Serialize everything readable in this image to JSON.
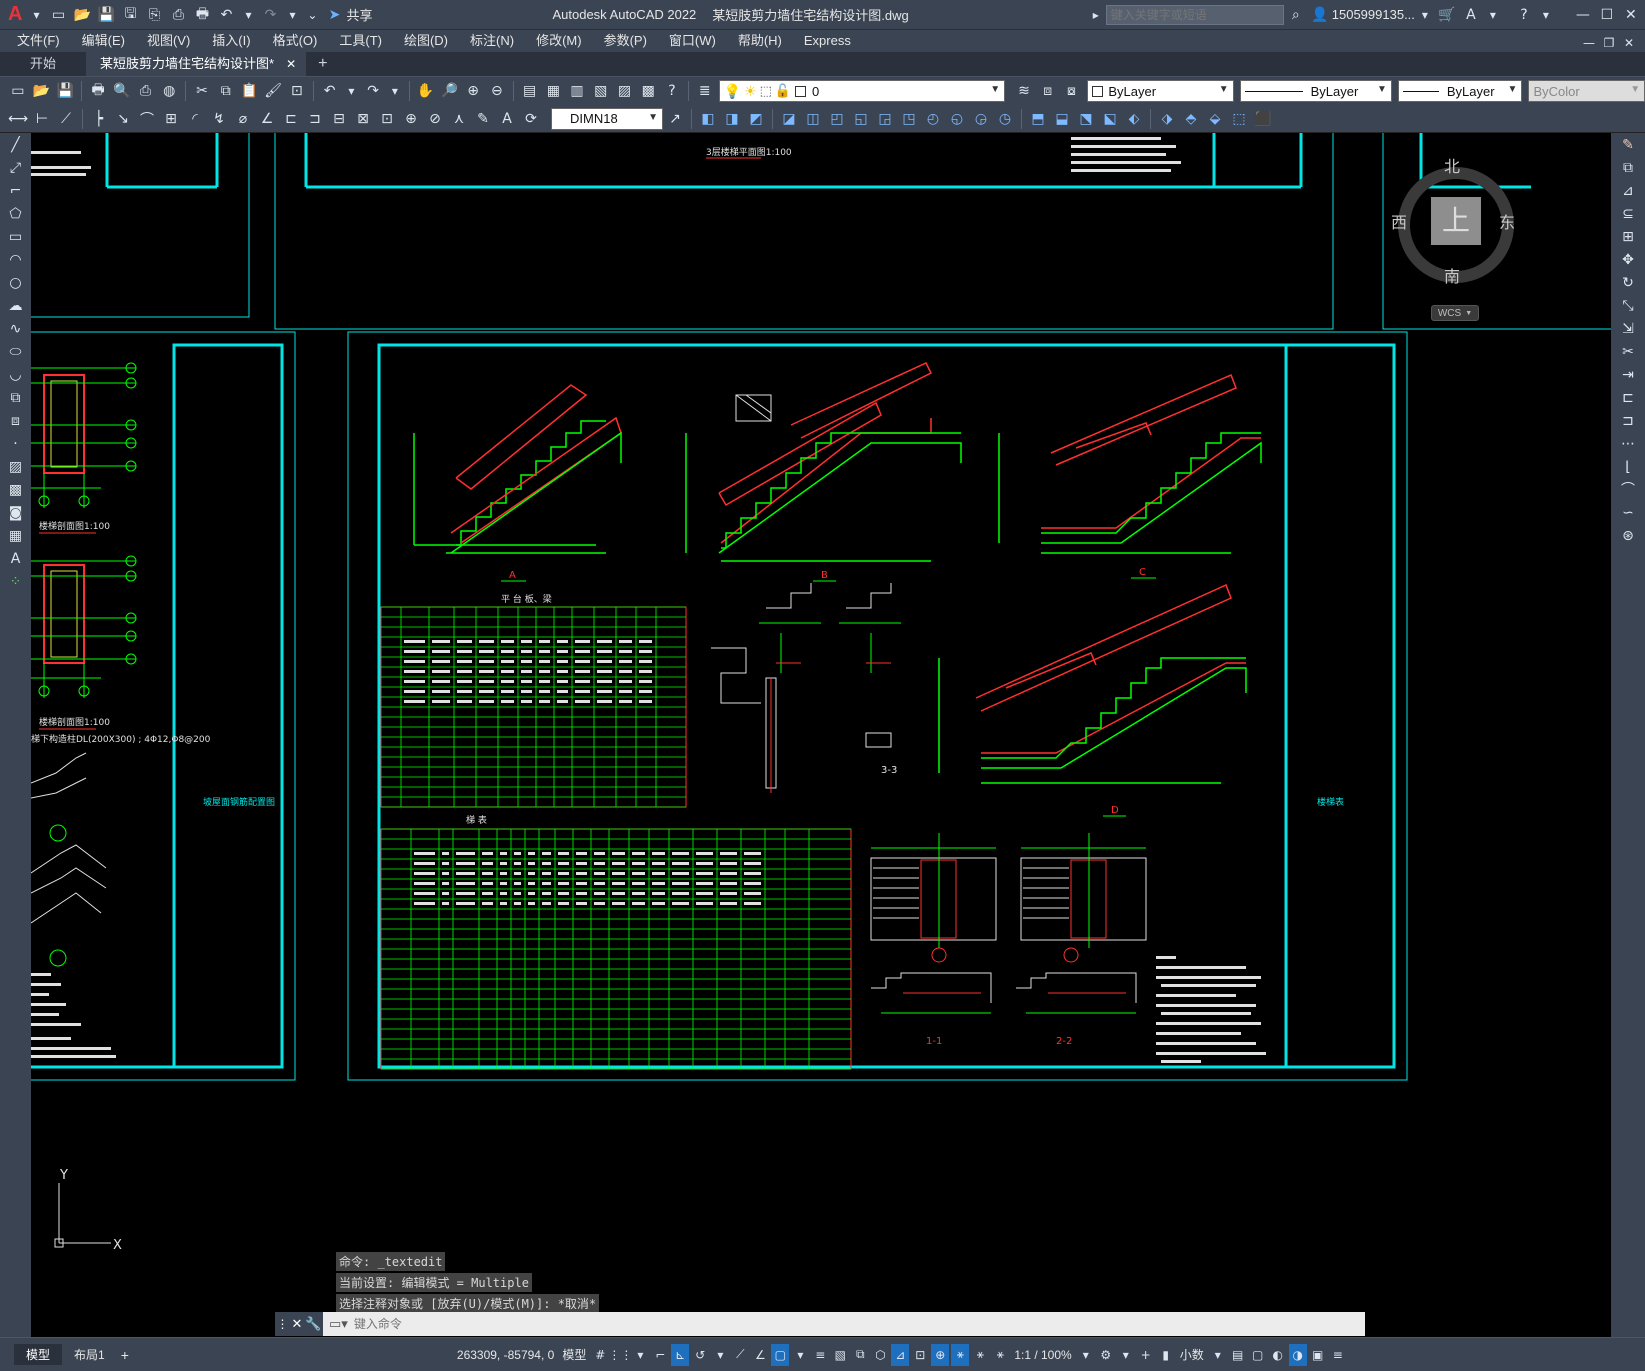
{
  "title": {
    "app_logo": "A",
    "app_name": "Autodesk AutoCAD 2022",
    "file_name": "某短肢剪力墙住宅结构设计图.dwg",
    "share_label": "共享",
    "search_placeholder": "键入关键字或短语",
    "user_label": "1505999135..."
  },
  "menu": [
    "文件(F)",
    "编辑(E)",
    "视图(V)",
    "插入(I)",
    "格式(O)",
    "工具(T)",
    "绘图(D)",
    "标注(N)",
    "修改(M)",
    "参数(P)",
    "窗口(W)",
    "帮助(H)",
    "Express"
  ],
  "tabs": {
    "start": "开始",
    "doc": "某短肢剪力墙住宅结构设计图*"
  },
  "toolbar": {
    "layer_value": "0",
    "color_value": "ByLayer",
    "linetype_value": "ByLayer",
    "lineweight_value": "ByLayer",
    "plotstyle_value": "ByColor",
    "dimstyle_value": "DIMN18"
  },
  "viewcube": {
    "north": "北",
    "south": "南",
    "east": "东",
    "west": "西",
    "top": "上",
    "wcs": "WCS"
  },
  "ucs": {
    "y": "Y",
    "x": "X"
  },
  "command": {
    "history": [
      "命令: _textedit",
      "当前设置: 编辑模式 = Multiple",
      "选择注释对象或 [放弃(U)/模式(M)]: *取消*"
    ],
    "placeholder": "键入命令"
  },
  "status": {
    "model_tab": "模型",
    "layout_tab": "布局1",
    "coords": "263309, -85794, 0",
    "space": "模型",
    "scale": "1:1 / 100%",
    "units": "小数"
  },
  "drawing": {
    "sheet_left_label": "坡屋面钢筋配置图",
    "sheet_right_label": "楼梯表",
    "label_a": "A",
    "label_b": "B",
    "label_c": "C",
    "label_d": "D",
    "label_11": "1-1",
    "label_22": "2-2",
    "label_33": "3-3",
    "table1_title": "平 台 板、梁",
    "table2_title": "梯     表",
    "scale_label_1": "楼梯剖面图1:100",
    "scale_label_2": "楼梯剖面图1:100",
    "scale_label_top": "3层楼梯平面图1:100",
    "beam_note": "梯下构造柱DL(200X300) ; 4Φ12,Φ8@200"
  }
}
